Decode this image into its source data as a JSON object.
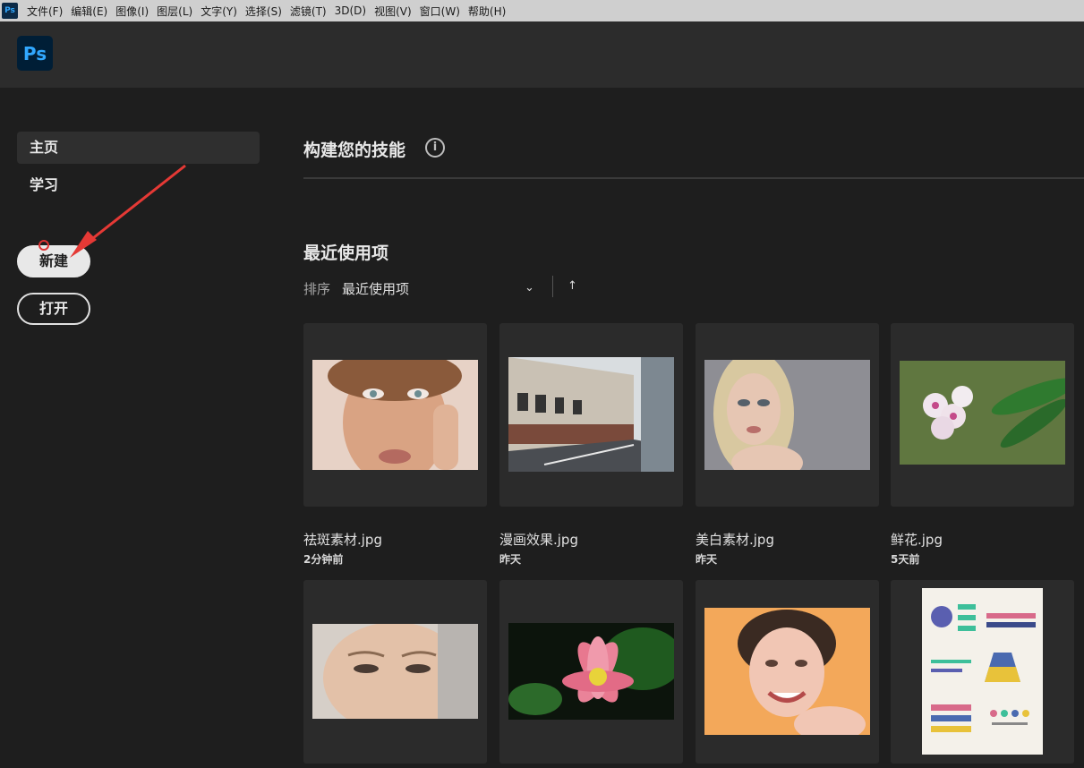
{
  "menubar": {
    "app_icon": "Ps",
    "items": [
      "文件(F)",
      "编辑(E)",
      "图像(I)",
      "图层(L)",
      "文字(Y)",
      "选择(S)",
      "滤镜(T)",
      "3D(D)",
      "视图(V)",
      "窗口(W)",
      "帮助(H)"
    ]
  },
  "topbar": {
    "logo": "Ps"
  },
  "sidebar": {
    "items": [
      {
        "label": "主页",
        "active": true
      },
      {
        "label": "学习",
        "active": false
      }
    ],
    "new_button": "新建",
    "open_button": "打开"
  },
  "main": {
    "skills_title": "构建您的技能",
    "info_icon": "i",
    "recent_title": "最近使用项",
    "sort_label": "排序",
    "sort_value": "最近使用项",
    "chevron_icon": "⌄",
    "up_arrow_icon": "↑"
  },
  "files": [
    {
      "name": "祛斑素材.jpg",
      "time": "2分钟前"
    },
    {
      "name": "漫画效果.jpg",
      "time": "昨天"
    },
    {
      "name": "美白素材.jpg",
      "time": "昨天"
    },
    {
      "name": "鲜花.jpg",
      "time": "5天前"
    },
    {
      "name": "",
      "time": ""
    },
    {
      "name": "",
      "time": ""
    },
    {
      "name": "",
      "time": ""
    },
    {
      "name": "",
      "time": ""
    }
  ],
  "colors": {
    "accent": "#31a8ff",
    "background": "#1e1e1e",
    "card": "#2b2b2b",
    "annotation_arrow": "#e53935"
  }
}
